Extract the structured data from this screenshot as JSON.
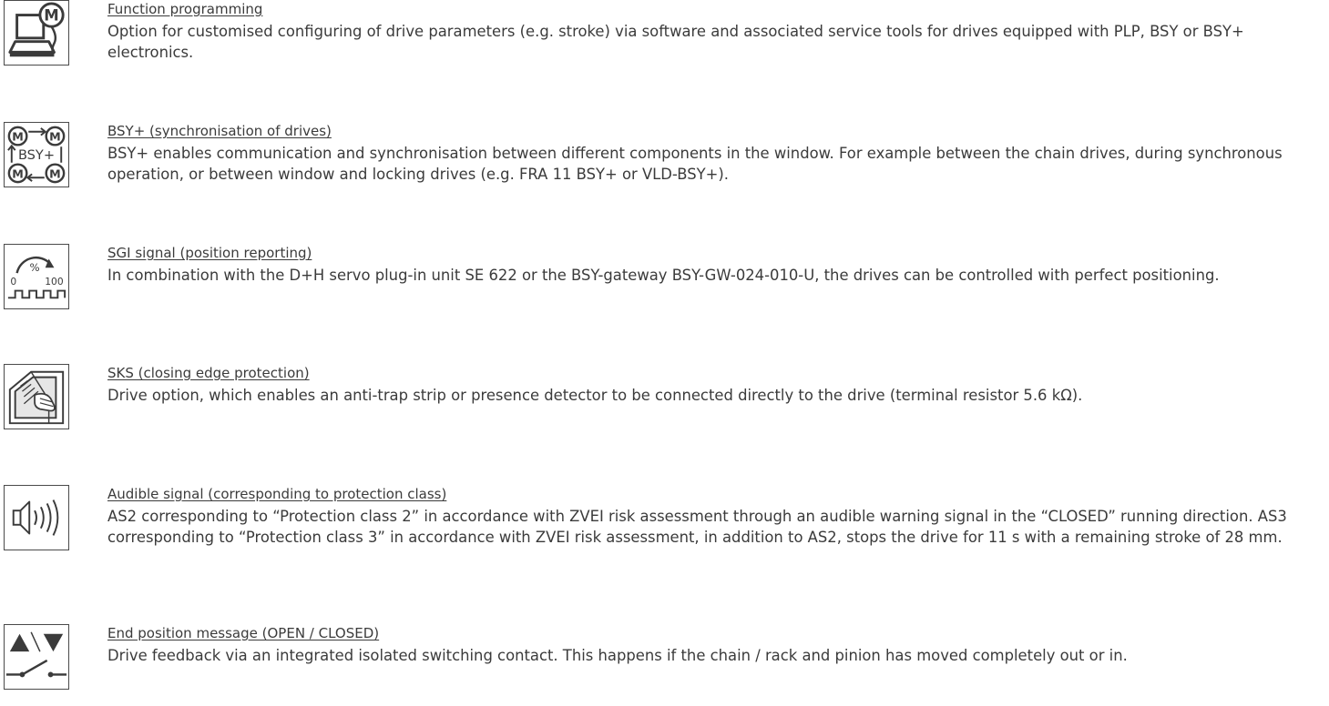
{
  "items": [
    {
      "icon": "laptop-motor-icon",
      "title": "Function programming",
      "description": "Option for customised configuring of drive parameters (e.g. stroke) via software and associated service tools for drives equipped with PLP, BSY or BSY+ electronics."
    },
    {
      "icon": "bsy-sync-icon",
      "title": "BSY+ (synchronisation of drives)",
      "description": "BSY+ enables communication and synchronisation between different components in the window. For example between the chain drives, during synchronous operation, or between window and locking drives (e.g. FRA 11 BSY+ or VLD-BSY+)."
    },
    {
      "icon": "position-gauge-icon",
      "title": "SGI signal (position reporting)",
      "description": "In combination with the D+H servo plug-in unit SE 622 or the BSY-gateway BSY-GW-024-010-U, the drives can be controlled with perfect positioning."
    },
    {
      "icon": "hand-window-icon",
      "title": "SKS (closing edge protection)",
      "description": "Drive option, which enables an anti-trap strip or presence detector to be connected directly to the drive (terminal resistor 5.6 kΩ)."
    },
    {
      "icon": "speaker-icon",
      "title": "Audible signal (corresponding to protection class)",
      "description": "AS2 corresponding to “Protection class 2” in accordance with ZVEI risk assessment through an audible warning signal in the “CLOSED” running direction. AS3 corresponding to “Protection class 3” in accordance with ZVEI risk assessment, in addition to AS2, stops the drive for 11 s with a remaining stroke of 28 mm."
    },
    {
      "icon": "end-switch-icon",
      "title": "End position message (OPEN / CLOSED)",
      "description": "Drive feedback via an integrated isolated switching contact. This happens if the chain / rack and pinion has moved completely out or in."
    }
  ],
  "icon_text": {
    "motor": "M",
    "bsy": "BSY+",
    "percent": "%",
    "zero": "0",
    "hundred": "100"
  },
  "colors": {
    "text": "#3b3b3b",
    "icon_stroke": "#4a4a4a"
  }
}
